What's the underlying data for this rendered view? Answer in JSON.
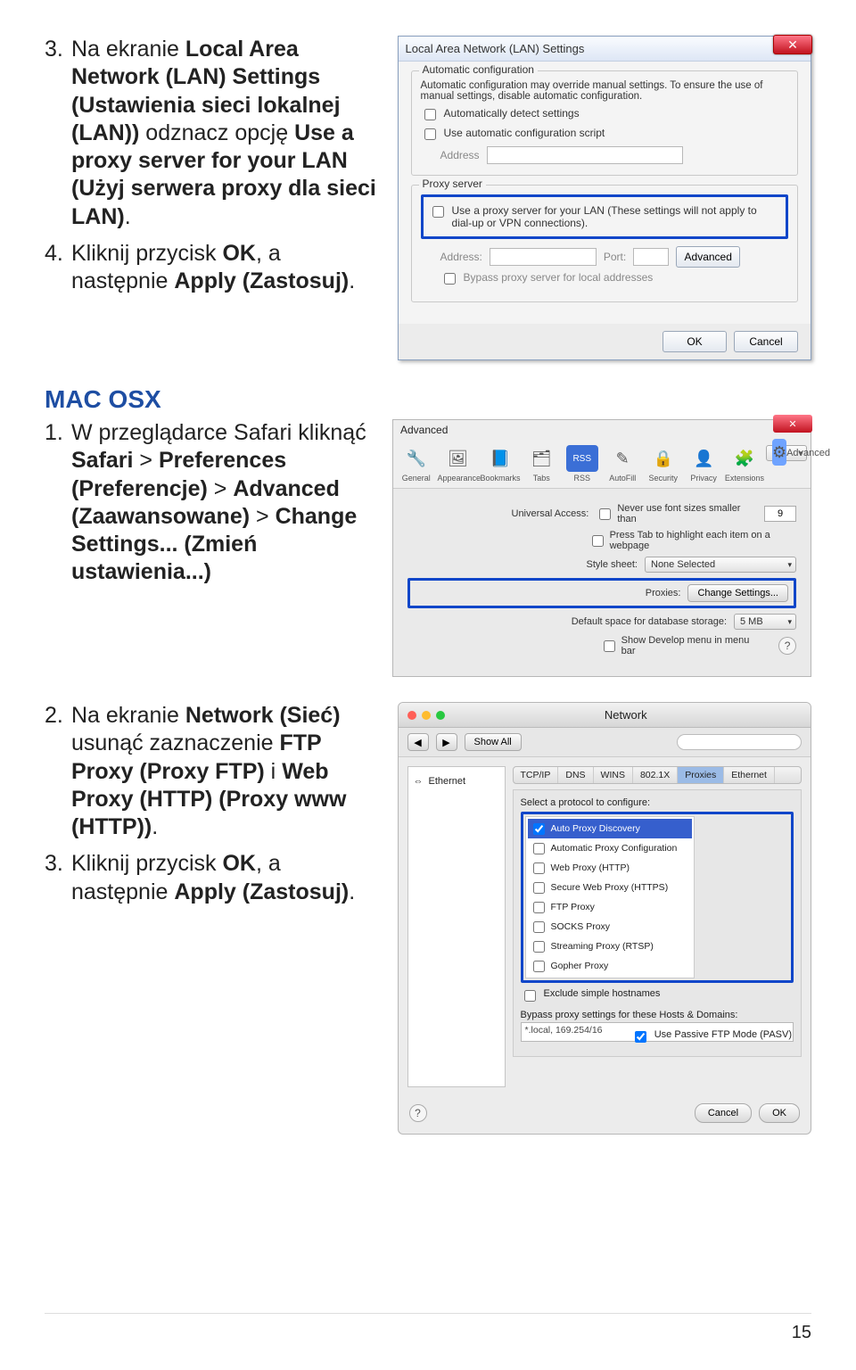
{
  "step3": {
    "num": "3.",
    "t1": "Na ekranie ",
    "b1": "Local Area Network (LAN) Settings (Ustawienia sieci lokalnej (LAN))",
    "t2": " odznacz opcję ",
    "b2": "Use a proxy server for your LAN (Użyj serwera proxy dla sieci LAN)",
    "t3": "."
  },
  "step4": {
    "num": "4.",
    "t1": "Kliknij przycisk ",
    "b1": "OK",
    "t2": ", a następnie ",
    "b2": "Apply (Zastosuj)",
    "t3": "."
  },
  "lan": {
    "title": "Local Area Network (LAN) Settings",
    "auto_group": "Automatic configuration",
    "auto_desc": "Automatic configuration may override manual settings. To ensure the use of manual settings, disable automatic configuration.",
    "chk_auto": "Automatically detect settings",
    "chk_script": "Use automatic configuration script",
    "address": "Address",
    "proxy_group": "Proxy server",
    "chk_proxy1": "Use a proxy server for your LAN (These settings will not apply to",
    "chk_proxy2": "dial-up or VPN connections).",
    "address2": "Address:",
    "port": "Port:",
    "advanced": "Advanced",
    "bypass": "Bypass proxy server for local addresses",
    "ok": "OK",
    "cancel": "Cancel"
  },
  "mac_heading": "MAC OSX",
  "mac1": {
    "num": "1.",
    "t1": "W przeglądarce Safari kliknąć ",
    "b1": "Safari",
    "t2": " > ",
    "b2": "Preferences (Preferencje)",
    "t3": " > ",
    "b3": "Advanced (Zaawansowane)",
    "t4": " > ",
    "b4": "Change Settings... (Zmień ustawienia...)"
  },
  "safari": {
    "title": "Advanced",
    "icons": [
      "General",
      "Appearance",
      "Bookmarks",
      "Tabs",
      "RSS",
      "AutoFill",
      "Security",
      "Privacy",
      "Extensions",
      "Advanced"
    ],
    "ua": "Universal Access:",
    "ua_chk": "Never use font sizes smaller than",
    "ua_val": "9",
    "press": "Press Tab to highlight each item on a webpage",
    "ss": "Style sheet:",
    "ss_val": "None Selected",
    "proxies": "Proxies:",
    "change": "Change Settings...",
    "db": "Default space for database storage:",
    "db_val": "5 MB",
    "dev": "Show Develop menu in menu bar"
  },
  "mac2": {
    "num": "2.",
    "t1": "Na ekranie ",
    "b1": "Network (Sieć)",
    "t2": " usunąć zaznaczenie ",
    "b2": "FTP Proxy (Proxy FTP)",
    "t3": " i ",
    "b3": "Web Proxy (HTTP) (Proxy www (HTTP))",
    "t4": "."
  },
  "mac3": {
    "num": "3.",
    "t1": "Kliknij przycisk ",
    "b1": "OK",
    "t2": ", a następnie ",
    "b2": "Apply (Zastosuj)",
    "t3": "."
  },
  "network": {
    "title": "Network",
    "showall": "Show All",
    "ethernet": "Ethernet",
    "tabs": [
      "TCP/IP",
      "DNS",
      "WINS",
      "802.1X",
      "Proxies",
      "Ethernet"
    ],
    "select_proto": "Select a protocol to configure:",
    "protocols": [
      "Auto Proxy Discovery",
      "Automatic Proxy Configuration",
      "Web Proxy (HTTP)",
      "Secure Web Proxy (HTTPS)",
      "FTP Proxy",
      "SOCKS Proxy",
      "Streaming Proxy (RTSP)",
      "Gopher Proxy"
    ],
    "exclude": "Exclude simple hostnames",
    "bypass": "Bypass proxy settings for these Hosts & Domains:",
    "bypass_val": "*.local, 169.254/16",
    "pasv": "Use Passive FTP Mode (PASV)",
    "cancel": "Cancel",
    "ok": "OK"
  },
  "page_number": "15"
}
